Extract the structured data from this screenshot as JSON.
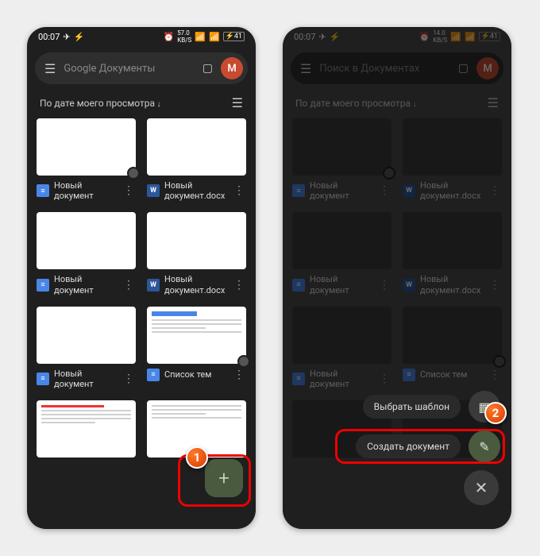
{
  "status": {
    "time1": "00:07",
    "time2": "00:07",
    "net1": "57.0",
    "net2": "14.0",
    "battery": "41"
  },
  "header": {
    "search1": "Google Документы",
    "search2": "Поиск в Документах",
    "avatar": "M"
  },
  "sort": {
    "label": "По дате моего просмотра"
  },
  "docs": [
    {
      "title": "Новый документ",
      "icon": "gdoc",
      "thumb": "blank",
      "badge": true
    },
    {
      "title": "Новый документ.docx",
      "icon": "word",
      "thumb": "blank",
      "badge": false
    },
    {
      "title": "Новый документ",
      "icon": "gdoc",
      "thumb": "blank",
      "badge": false
    },
    {
      "title": "Новый документ.docx",
      "icon": "word",
      "thumb": "blank",
      "badge": false
    },
    {
      "title": "Новый документ",
      "icon": "gdoc",
      "thumb": "blank",
      "badge": false
    },
    {
      "title": "Список тем",
      "icon": "gdoc",
      "thumb": "content",
      "badge": true
    }
  ],
  "actions": {
    "template": "Выбрать шаблон",
    "create": "Создать документ"
  },
  "markers": {
    "one": "1",
    "two": "2"
  }
}
